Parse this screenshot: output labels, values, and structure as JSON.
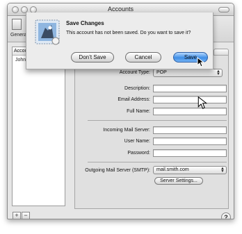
{
  "window": {
    "title": "Accounts"
  },
  "toolbar": {
    "general_label": "General"
  },
  "accounts_list": {
    "header": "Accounts",
    "rows": [
      "John Smith"
    ]
  },
  "form": {
    "account_type_label": "Account Type:",
    "account_type_value": "POP",
    "description_label": "Description:",
    "description_value": "",
    "email_label": "Email Address:",
    "email_value": "",
    "fullname_label": "Full Name:",
    "fullname_value": "",
    "incoming_label": "Incoming Mail Server:",
    "incoming_value": "",
    "username_label": "User Name:",
    "username_value": "",
    "password_label": "Password:",
    "password_value": "",
    "smtp_label": "Outgoing Mail Server (SMTP):",
    "smtp_value": "mail.smith.com",
    "server_settings_label": "Server Settings..."
  },
  "bottom": {
    "add_label": "+",
    "remove_label": "−",
    "help_label": "?"
  },
  "sheet": {
    "title": "Save Changes",
    "message": "This account has not been saved.  Do you want to save it?",
    "dont_save_label": "Don’t Save",
    "cancel_label": "Cancel",
    "save_label": "Save"
  },
  "colors": {
    "default_button": "#3f8ee6",
    "window_bg": "#e6e6e6"
  }
}
